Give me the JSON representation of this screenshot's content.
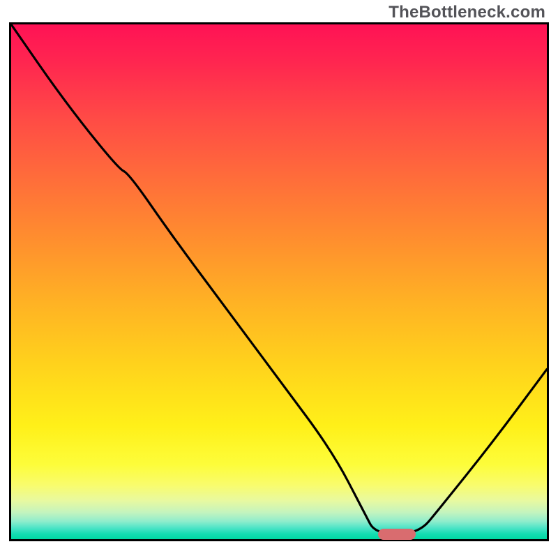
{
  "watermark": "TheBottleneck.com",
  "chart_data": {
    "type": "line",
    "title": "",
    "xlabel": "",
    "ylabel": "",
    "xlim": [
      0,
      100
    ],
    "ylim": [
      0,
      100
    ],
    "description": "Single black curve on rainbow vertical gradient. Curve starts top-left, descends with slight knee near x≈22,y≈71, dives to a flat trough around x≈68–76 at y≈1, then rises to y≈33 at x=100. A small rounded salmon marker sits at the trough.",
    "series": [
      {
        "name": "bottleneck-curve",
        "x": [
          0,
          10,
          20,
          22,
          30,
          40,
          50,
          60,
          66,
          68,
          76,
          80,
          90,
          100
        ],
        "y": [
          100,
          85,
          72,
          71,
          59,
          45,
          31,
          17,
          5,
          1,
          1,
          6,
          19,
          33
        ]
      }
    ],
    "marker": {
      "x": 72,
      "y": 1,
      "width_pct": 7,
      "color": "#d96c6f"
    },
    "gradient_stops": [
      {
        "pct": 0,
        "color": "#ff1255"
      },
      {
        "pct": 50,
        "color": "#ffb224"
      },
      {
        "pct": 85,
        "color": "#fdfd3a"
      },
      {
        "pct": 100,
        "color": "#00d9a2"
      }
    ]
  }
}
